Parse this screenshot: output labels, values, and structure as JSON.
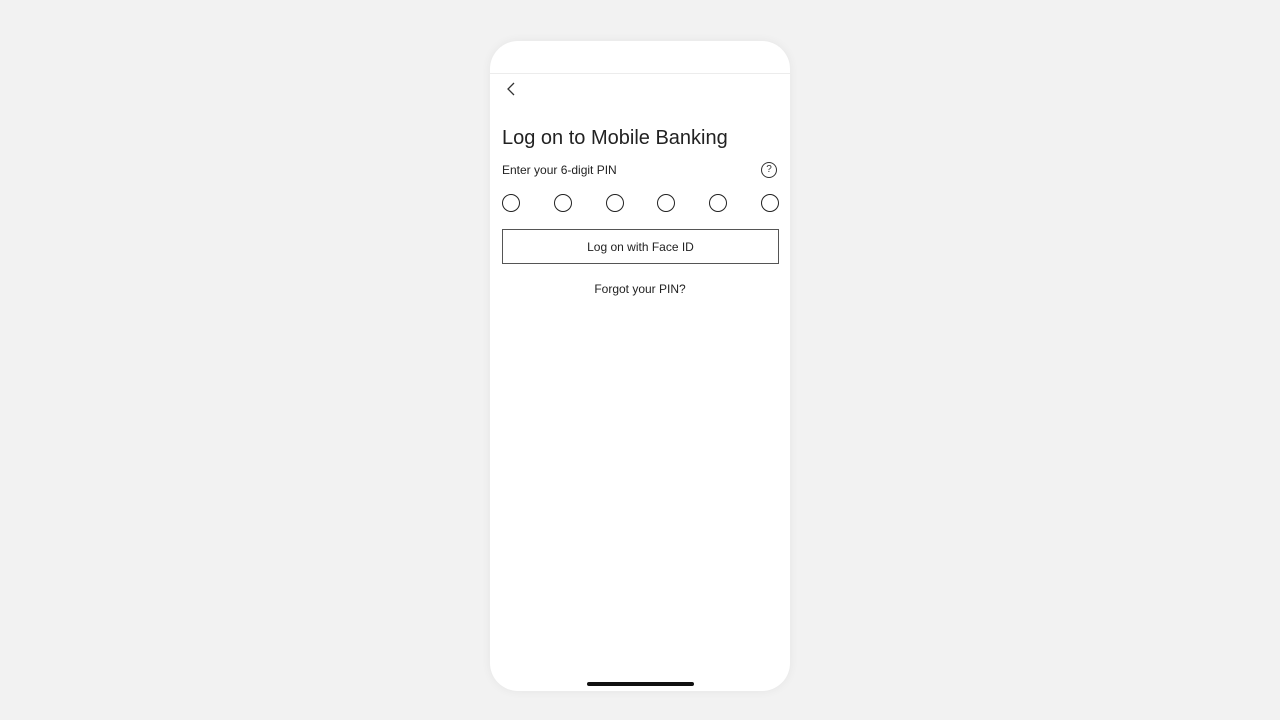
{
  "screen": {
    "title": "Log on to Mobile Banking",
    "pin_label": "Enter your 6-digit PIN",
    "help_icon": "question-circle-icon",
    "help_glyph": "?",
    "back_icon": "chevron-left-icon",
    "pin_length": 6,
    "pin_entered": 0,
    "face_id_button": "Log on with Face ID",
    "forgot_link": "Forgot your PIN?"
  }
}
